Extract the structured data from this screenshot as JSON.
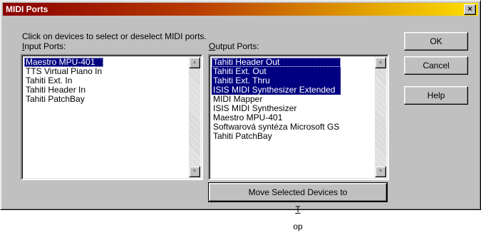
{
  "window": {
    "title": "MIDI Ports",
    "close_glyph": "×"
  },
  "instruction": "Click on devices to select or deselect MIDI ports.",
  "input_ports": {
    "label_accel": "I",
    "label_rest": "nput Ports:",
    "items": [
      {
        "label": "Maestro MPU-401",
        "selected": true
      },
      {
        "label": "TTS Virtual Piano In",
        "selected": false
      },
      {
        "label": "Tahiti Ext. In",
        "selected": false
      },
      {
        "label": "Tahiti Header In",
        "selected": false
      },
      {
        "label": "Tahiti PatchBay",
        "selected": false
      }
    ]
  },
  "output_ports": {
    "label_accel": "O",
    "label_rest": "utput Ports:",
    "items": [
      {
        "label": "Tahiti Header Out",
        "selected": true
      },
      {
        "label": "Tahiti Ext. Out",
        "selected": true
      },
      {
        "label": "Tahiti Ext. Thru",
        "selected": true
      },
      {
        "label": "ISIS MIDI Synthesizer Extended",
        "selected": true
      },
      {
        "label": "MIDI Mapper",
        "selected": false
      },
      {
        "label": "ISIS MIDI Synthesizer",
        "selected": false
      },
      {
        "label": "Maestro MPU-401",
        "selected": false
      },
      {
        "label": "Softwarová syntéza Microsoft GS",
        "selected": false
      },
      {
        "label": "Tahiti PatchBay",
        "selected": false
      }
    ]
  },
  "buttons": {
    "ok": "OK",
    "cancel": "Cancel",
    "help": "Help",
    "move_prefix": "Move Selected Devices to ",
    "move_accel": "T",
    "move_suffix": "op"
  },
  "icons": {
    "scroll_up": "▲",
    "scroll_down": "▼"
  }
}
